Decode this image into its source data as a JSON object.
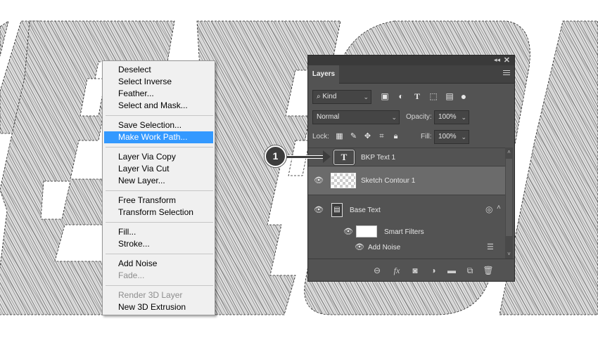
{
  "context_menu": {
    "items": [
      {
        "label": "Deselect"
      },
      {
        "label": "Select Inverse"
      },
      {
        "label": "Feather..."
      },
      {
        "label": "Select and Mask..."
      },
      {
        "label": "Save Selection..."
      },
      {
        "label": "Make Work Path..."
      },
      {
        "label": "Layer Via Copy"
      },
      {
        "label": "Layer Via Cut"
      },
      {
        "label": "New Layer..."
      },
      {
        "label": "Free Transform"
      },
      {
        "label": "Transform Selection"
      },
      {
        "label": "Fill..."
      },
      {
        "label": "Stroke..."
      },
      {
        "label": "Add Noise"
      },
      {
        "label": "Fade..."
      },
      {
        "label": "Render 3D Layer"
      },
      {
        "label": "New 3D Extrusion"
      }
    ],
    "selected": "Make Work Path...",
    "disabled": [
      "Fade...",
      "Render 3D Layer"
    ]
  },
  "layers_panel": {
    "tab": "Layers",
    "filter": {
      "kind_label": "Kind"
    },
    "blend_mode": "Normal",
    "opacity_label": "Opacity:",
    "opacity_value": "100%",
    "lock_label": "Lock:",
    "fill_label": "Fill:",
    "fill_value": "100%",
    "layers": [
      {
        "name": "BKP Text 1",
        "type": "text",
        "visible": false
      },
      {
        "name": "Sketch Contour 1",
        "type": "raster",
        "visible": true,
        "selected": true
      },
      {
        "name": "Base Text",
        "type": "smart-object",
        "visible": true
      },
      {
        "name": "Smart Filters",
        "type": "smart-filters",
        "visible": true
      },
      {
        "name": "Add Noise",
        "type": "filter",
        "visible": true
      }
    ],
    "text_layer_glyph": "T"
  },
  "callout": {
    "number": "1"
  },
  "colors": {
    "menu_selected": "#3399ff",
    "panel_bg": "#535353",
    "selected_layer_bg": "#6b6b6b"
  }
}
